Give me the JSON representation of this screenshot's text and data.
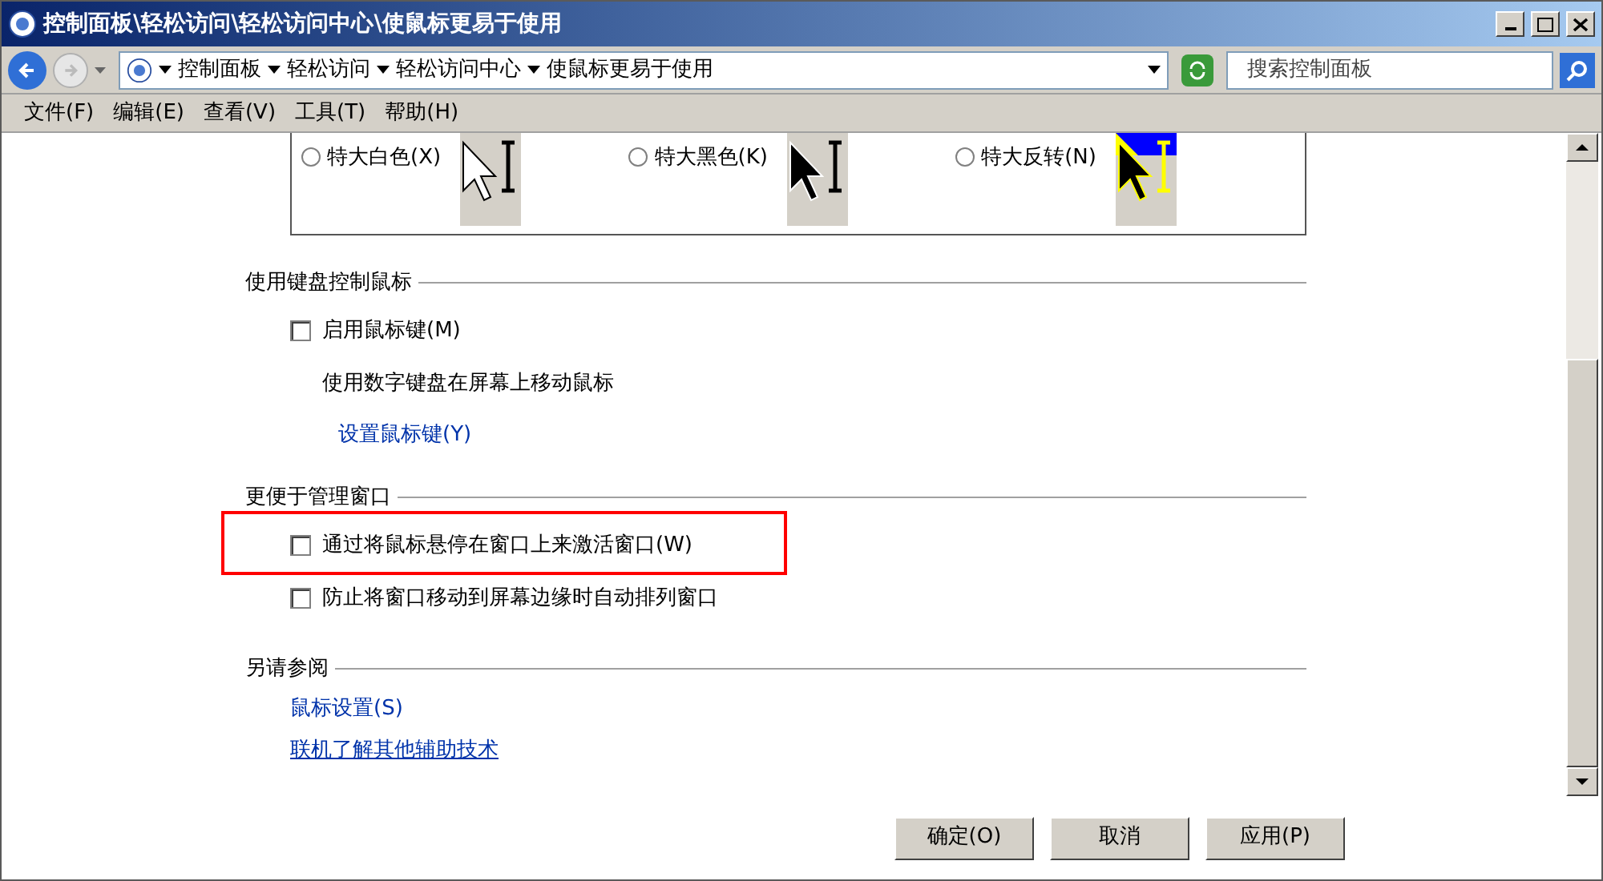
{
  "window": {
    "title": "控制面板\\轻松访问\\轻松访问中心\\使鼠标更易于使用"
  },
  "address_bar": {
    "crumbs": [
      "控制面板",
      "轻松访问",
      "轻松访问中心",
      "使鼠标更易于使用"
    ]
  },
  "search": {
    "placeholder": "搜索控制面板"
  },
  "menu": [
    "文件(F)",
    "编辑(E)",
    "查看(V)",
    "工具(T)",
    "帮助(H)"
  ],
  "pointer_schemes": [
    {
      "label": "特大白色(X)",
      "selected": false,
      "kind": "white"
    },
    {
      "label": "特大黑色(K)",
      "selected": false,
      "kind": "black"
    },
    {
      "label": "特大反转(N)",
      "selected": false,
      "kind": "inverted"
    }
  ],
  "sections": [
    {
      "title": "使用键盘控制鼠标",
      "items": [
        {
          "kind": "checkbox",
          "label": "启用鼠标键(M)",
          "checked": false,
          "highlighted": false
        },
        {
          "kind": "text",
          "label": "使用数字键盘在屏幕上移动鼠标"
        },
        {
          "kind": "link",
          "label": "设置鼠标键(Y)",
          "underlined": false
        }
      ]
    },
    {
      "title": "更便于管理窗口",
      "items": [
        {
          "kind": "checkbox",
          "label": "通过将鼠标悬停在窗口上来激活窗口(W)",
          "checked": false,
          "highlighted": true
        },
        {
          "kind": "checkbox",
          "label": "防止将窗口移动到屏幕边缘时自动排列窗口",
          "checked": false,
          "highlighted": false
        }
      ]
    },
    {
      "title": "另请参阅",
      "items": [
        {
          "kind": "link",
          "label": "鼠标设置(S)",
          "underlined": false
        },
        {
          "kind": "link",
          "label": "联机了解其他辅助技术",
          "underlined": true
        }
      ]
    }
  ],
  "buttons": [
    "确定(O)",
    "取消",
    "应用(P)"
  ]
}
